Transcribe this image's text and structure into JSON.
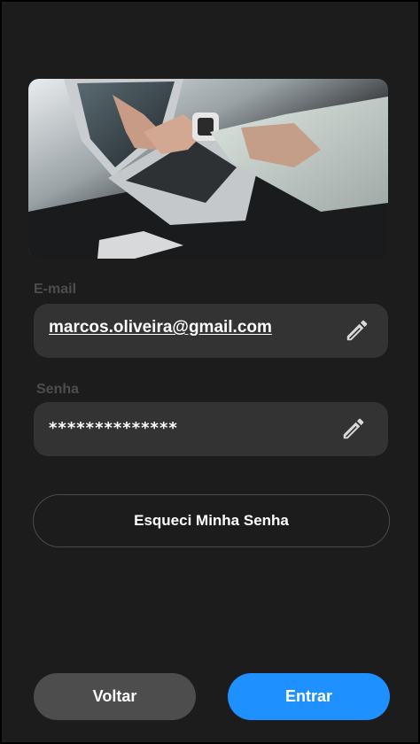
{
  "form": {
    "email_label": "E-mail",
    "email_value": "marcos.oliveira@gmail.com",
    "password_label": "Senha",
    "password_value": "**************"
  },
  "actions": {
    "forgot_label": "Esqueci Minha Senha",
    "back_label": "Voltar",
    "enter_label": "Entrar"
  },
  "icons": {
    "edit_email": "pencil-icon",
    "edit_password": "pencil-icon"
  },
  "colors": {
    "background": "#1c1c1c",
    "field": "#333333",
    "label": "#4d4d4d",
    "primary": "#1e90ff",
    "secondary": "#4d4d4d"
  }
}
